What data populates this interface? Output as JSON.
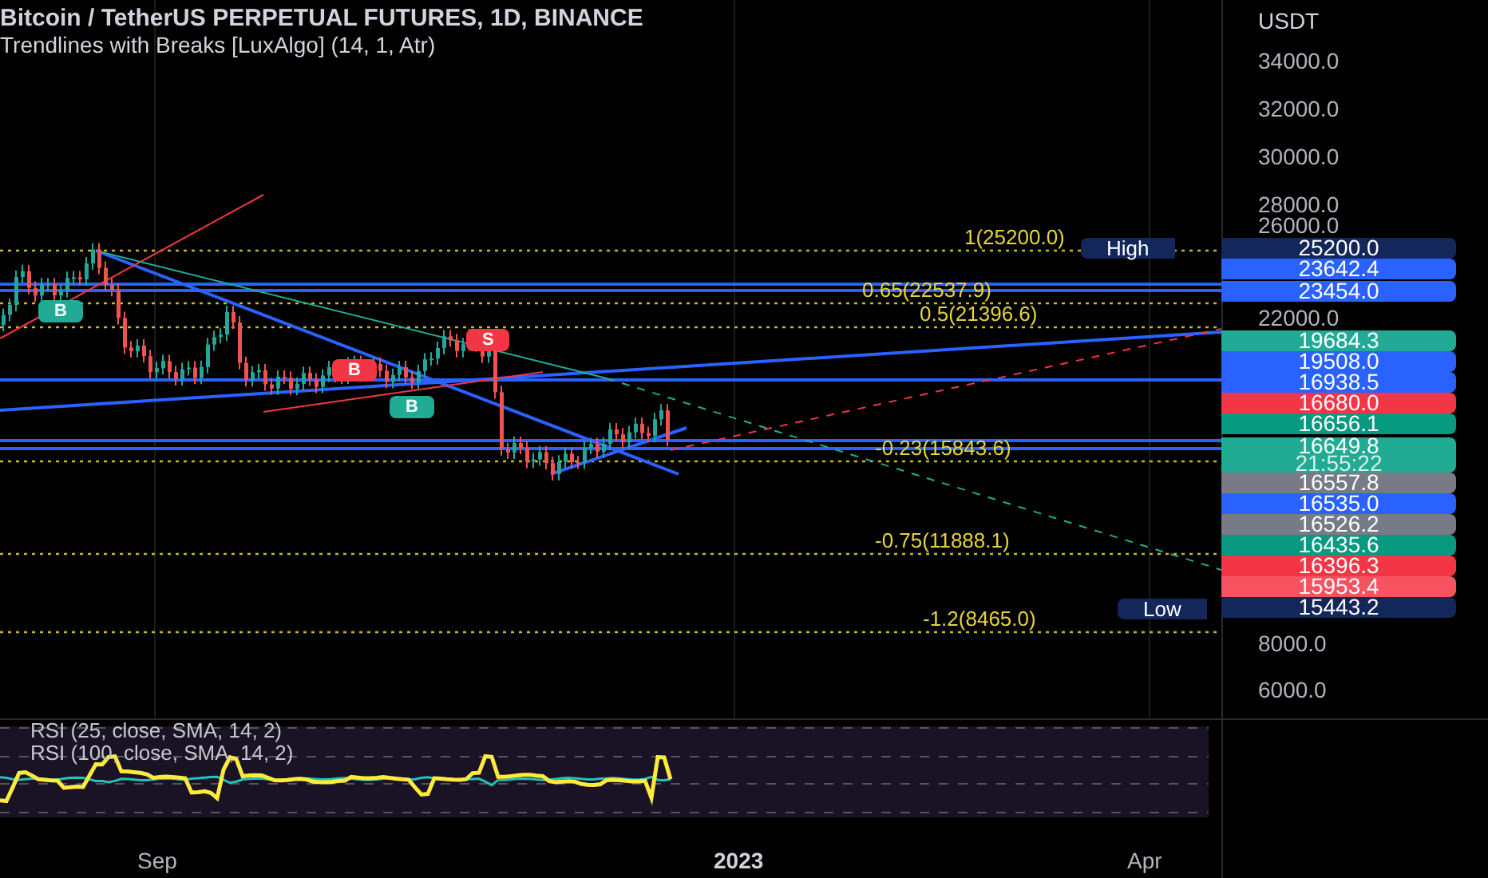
{
  "header": {
    "title": "Bitcoin / TetherUS PERPETUAL FUTURES, 1D, BINANCE",
    "indicator": "Trendlines with Breaks [LuxAlgo] (14, 1, Atr)"
  },
  "price_axis": {
    "currency": "USDT",
    "labels": [
      {
        "text": "34000.0",
        "kind": "plain"
      },
      {
        "text": "32000.0",
        "kind": "plain"
      },
      {
        "text": "30000.0",
        "kind": "plain"
      },
      {
        "text": "28000.0",
        "kind": "plain"
      },
      {
        "text": "26000.0",
        "kind": "plain"
      },
      {
        "text": "25200.0",
        "kind": "tag",
        "color": "#13275a"
      },
      {
        "text": "23642.4",
        "kind": "tag",
        "color": "#2962ff"
      },
      {
        "text": "23454.0",
        "kind": "tag",
        "color": "#2962ff"
      },
      {
        "text": "22000.0",
        "kind": "plain"
      },
      {
        "text": "19684.3",
        "kind": "tag",
        "color": "#22ab94"
      },
      {
        "text": "19508.0",
        "kind": "tag",
        "color": "#2962ff"
      },
      {
        "text": "16938.5",
        "kind": "tag",
        "color": "#2962ff"
      },
      {
        "text": "16680.0",
        "kind": "tag",
        "color": "#f23645"
      },
      {
        "text": "16656.1",
        "kind": "tag",
        "color": "#089981"
      },
      {
        "text": "16649.8",
        "kind": "tag",
        "color": "#22ab94",
        "subtext": "21:55:22"
      },
      {
        "text": "16557.8",
        "kind": "tag",
        "color": "#787b86"
      },
      {
        "text": "16535.0",
        "kind": "tag",
        "color": "#2962ff"
      },
      {
        "text": "16526.2",
        "kind": "tag",
        "color": "#787b86"
      },
      {
        "text": "16435.6",
        "kind": "tag",
        "color": "#089981"
      },
      {
        "text": "16396.3",
        "kind": "tag",
        "color": "#f23645"
      },
      {
        "text": "15953.4",
        "kind": "tag",
        "color": "#f7525f"
      },
      {
        "text": "15443.2",
        "kind": "tag",
        "color": "#13275a"
      },
      {
        "text": "8000.0",
        "kind": "plain"
      },
      {
        "text": "6000.0",
        "kind": "plain"
      }
    ]
  },
  "fib_levels": [
    "1(25200.0)",
    "0.65(22537.9)",
    "0.5(21396.6)",
    "-0.23(15843.6)",
    "-0.75(11888.1)",
    "-1.2(8465.0)"
  ],
  "extremes": [
    "High",
    "Low"
  ],
  "signals": [
    {
      "text": "B",
      "color": "#22ab94"
    },
    {
      "text": "B",
      "color": "#f23645"
    },
    {
      "text": "B",
      "color": "#22ab94"
    },
    {
      "text": "S",
      "color": "#f23645"
    }
  ],
  "rsi": {
    "labels": [
      "RSI (25, close, SMA, 14, 2)",
      "RSI (100, close, SMA, 14, 2)"
    ]
  },
  "time_axis": [
    {
      "text": "Sep",
      "kind": "month"
    },
    {
      "text": "2023",
      "kind": "year"
    },
    {
      "text": "Apr",
      "kind": "month"
    }
  ]
}
